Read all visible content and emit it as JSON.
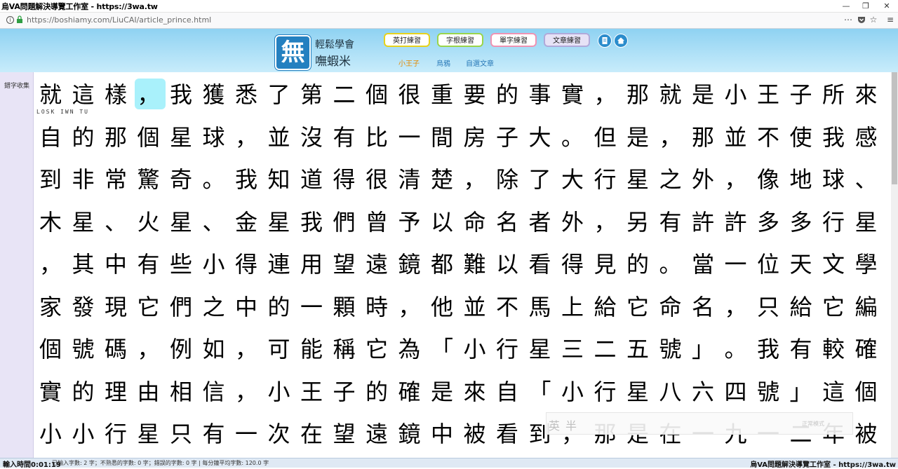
{
  "window": {
    "title": "烏VA問題解決導覽工作室 - https://3wa.tw",
    "buttons": [
      "—",
      "❐",
      "✕"
    ]
  },
  "addressbar": {
    "url": "https://boshiamy.com/LiuCAI/article_prince.html",
    "icons": [
      "more-icon",
      "pocket-icon",
      "star-icon"
    ]
  },
  "logo": {
    "glyph": "無",
    "line1": "輕鬆學會",
    "line2": "嘸蝦米"
  },
  "nav": {
    "en": "英打練習",
    "root": "字根練習",
    "single": "單字練習",
    "article": "文章練習",
    "sub": [
      "小王子",
      "烏鴉",
      "自選文章"
    ]
  },
  "sidebar": {
    "label": "錯字收集"
  },
  "article": {
    "romanization": "LOSK  IWN   TU",
    "lines": [
      "就這樣，我獲悉了第二個很重要的事實，那就是小王子所來",
      "自的那個星球，並沒有比一間房子大。但是，那並不使我感",
      "到非常驚奇。我知道得很清楚，除了大行星之外，像地球、",
      "木星、火星、金星我們曾予以命名者外，另有許許多多行星",
      "，其中有些小得連用望遠鏡都難以看得見的。當一位天文學",
      "家發現它們之中的一顆時，他並不馬上給它命名，只給它編",
      "個號碼，例如，可能稱它為「小行星三二五號」。我有較確",
      "實的理由相信，小王子的確是來自「小行星八六四號」這個",
      "小小行星只有一次在望遠鏡中被看到，那是在一九一二年被"
    ]
  },
  "ime": {
    "mode1": "英",
    "mode2": "半",
    "mode_label": "正常模式"
  },
  "footer": {
    "timer": "輸入時間0:01:19",
    "stats": "已輸入字數: 2 字；不熟悉的字數: 0 字；錯誤的字數: 0 字 | 每分鐘平均字數: 120.0 字",
    "brand": "烏VA問題解決導覽工作室 - https://3wa.tw"
  },
  "colors": {
    "header_top": "#8fd2f2",
    "header_bottom": "#c8ecfb",
    "logo_blue": "#2480c0",
    "cursor_highlight": "#a9f1fb",
    "sidebar": "#e8e4f6",
    "subnav_active": "#e58a00",
    "subnav_link": "#2a7ab8"
  }
}
